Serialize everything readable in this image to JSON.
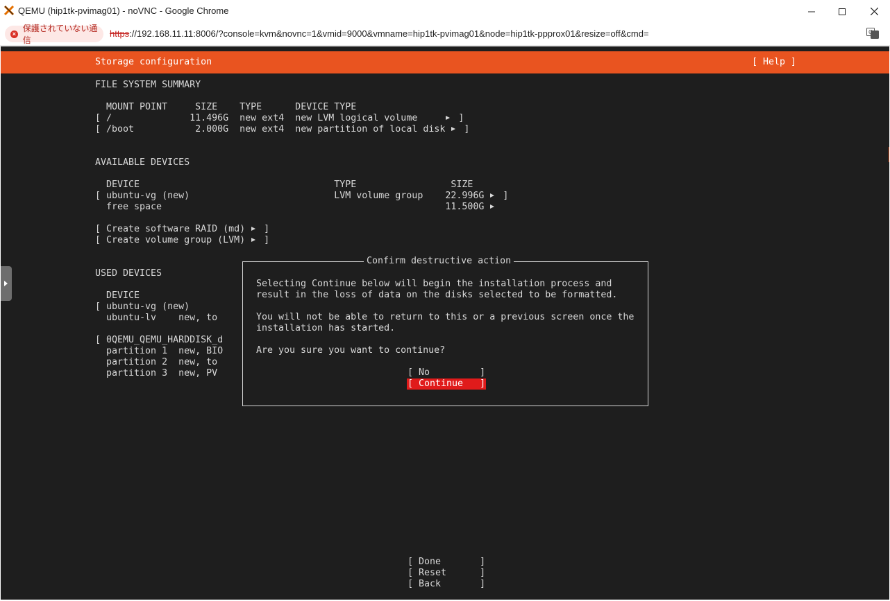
{
  "window": {
    "title": "QEMU (hip1tk-pvimag01) - noVNC - Google Chrome"
  },
  "address_bar": {
    "security_label": "保護されていない通信",
    "url_scheme": "https",
    "url_rest": "://192.168.11.11:8006/?console=kvm&novnc=1&vmid=9000&vmname=hip1tk-pvimag01&node=hip1tk-ppprox01&resize=off&cmd="
  },
  "installer": {
    "header_title": "Storage configuration",
    "help_button": "[ Help ]",
    "fs_summary_heading": "FILE SYSTEM SUMMARY",
    "fs_columns": "MOUNT POINT     SIZE    TYPE      DEVICE TYPE",
    "fs_rows": [
      {
        "open": "[",
        "text": " /              11.496G  new ext4  new LVM logical volume     ",
        "close": " ]"
      },
      {
        "open": "[",
        "text": " /boot           2.000G  new ext4  new partition of local disk ",
        "close": " ]"
      }
    ],
    "available_heading": "AVAILABLE DEVICES",
    "available_columns": "DEVICE                                   TYPE                 SIZE",
    "available_rows": [
      {
        "text": "[ ubuntu-vg (new)                          LVM volume group    22.996G ",
        "close": " ]"
      },
      {
        "text": "  free space                                                   11.500G ",
        "close": ""
      }
    ],
    "create_raid": "[ Create software RAID (md) ",
    "create_lvm": "[ Create volume group (LVM) ",
    "create_close": " ]",
    "used_heading": "USED DEVICES",
    "used_columns": "DEVICE",
    "used_rows": [
      "[ ubuntu-vg (new)",
      "  ubuntu-lv    new, to",
      "",
      "[ 0QEMU_QEMU_HARDDISK_d",
      "  partition 1  new, BIO",
      "  partition 2  new, to",
      "  partition 3  new, PV"
    ],
    "bottom_buttons": {
      "done": "[ Done       ]",
      "reset": "[ Reset      ]",
      "back": "[ Back       ]"
    }
  },
  "dialog": {
    "title": "Confirm destructive action",
    "lines": [
      "Selecting Continue below will begin the installation process and",
      "result in the loss of data on the disks selected to be formatted.",
      "",
      "You will not be able to return to this or a previous screen once the",
      "installation has started.",
      "",
      "Are you sure you want to continue?"
    ],
    "no_button": "[ No         ]",
    "continue_button": "[ Continue   ]"
  },
  "colors": {
    "ubuntu_orange": "#e95420",
    "terminal_bg": "#1e1e1e",
    "focus_red": "#e01b1b"
  },
  "icons": [
    "proxmox-logo-icon",
    "minimize-icon",
    "maximize-icon",
    "close-icon",
    "not-secure-icon",
    "translate-icon",
    "novnc-control-bar-handle"
  ]
}
